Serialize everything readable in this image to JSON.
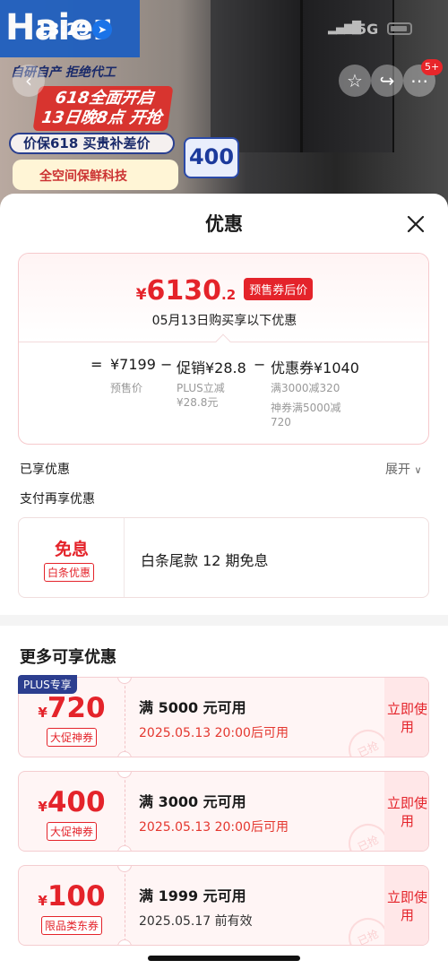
{
  "status_bar": {
    "time": "13:29",
    "network": "5G"
  },
  "background": {
    "brand": "Haier",
    "slogan": "自研自产 拒绝代工",
    "promo_line1": "618全面开启",
    "promo_line2": "13日晚8点 开抢",
    "price_banner": "价保618 买贵补差价",
    "badge": "400",
    "tech_banner": "全空间保鲜科技",
    "cart_count": "5+"
  },
  "sheet": {
    "title": "优惠",
    "summary": {
      "currency": "¥",
      "price_int": "6130",
      "price_dec": ".2",
      "price_tag": "预售券后价",
      "purchase_note": "05月13日购买享以下优惠",
      "formula": {
        "eq": "=",
        "presale": "¥7199",
        "presale_label": "预售价",
        "minus1": "−",
        "promo": "促销¥28.8",
        "promo_note1": "PLUS立减",
        "promo_note2": "¥28.8元",
        "minus2": "−",
        "coupon": "优惠券¥1040",
        "coupon_note1": "满3000减320",
        "coupon_note2": "神券满5000减",
        "coupon_note3": "720"
      }
    },
    "enjoyed_label": "已享优惠",
    "expand_label": "展开",
    "pay_more_label": "支付再享优惠",
    "interest": {
      "title": "免息",
      "tag": "白条优惠",
      "desc": "白条尾款 12 期免息"
    },
    "more_title": "更多可享优惠",
    "coupons": [
      {
        "badge": "PLUS专享",
        "currency": "¥",
        "amount": "720",
        "tag": "大促神券",
        "cond": "满 5000 元可用",
        "time": "2025.05.13 20:00后可用",
        "use": "立即使用",
        "stamp": "已抢"
      },
      {
        "currency": "¥",
        "amount": "400",
        "tag": "大促神券",
        "cond": "满 3000 元可用",
        "time": "2025.05.13 20:00后可用",
        "use": "立即使用",
        "stamp": "已抢"
      },
      {
        "currency": "¥",
        "amount": "100",
        "tag": "限品类东券",
        "cond": "满 1999 元可用",
        "time": "2025.05.17 前有效",
        "use": "立即使用",
        "stamp": "已抢"
      }
    ]
  }
}
